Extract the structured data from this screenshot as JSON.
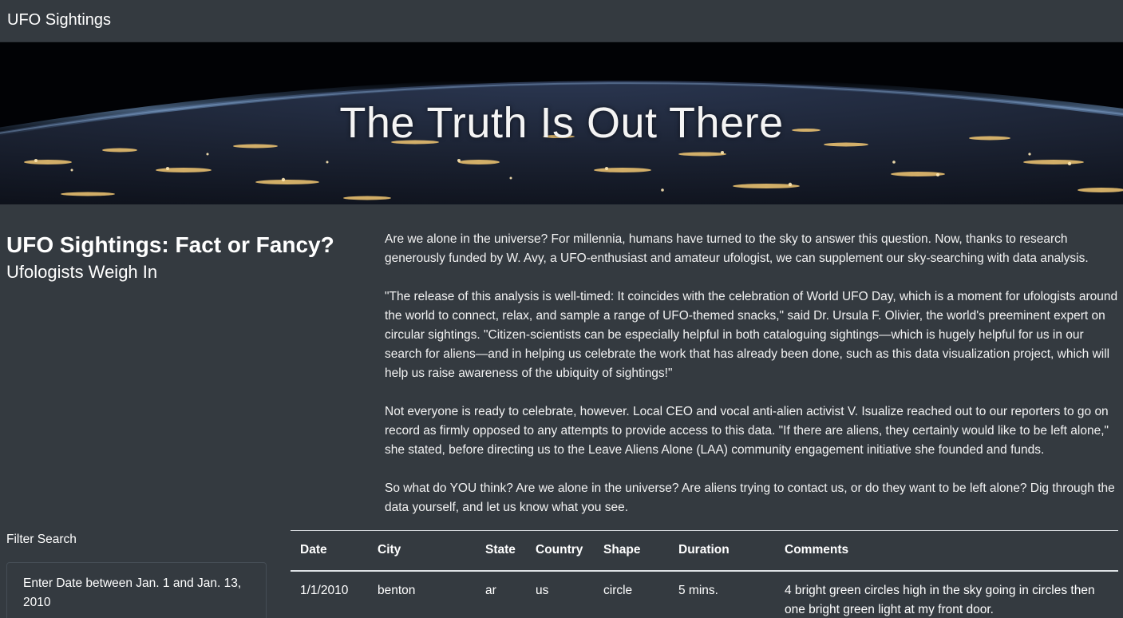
{
  "navbar": {
    "brand": "UFO Sightings"
  },
  "hero": {
    "title": "The Truth Is Out There"
  },
  "intro": {
    "title": "UFO Sightings: Fact or Fancy?",
    "subtitle": "Ufologists Weigh In"
  },
  "article": {
    "paragraphs": [
      "Are we alone in the universe? For millennia, humans have turned to the sky to answer this question. Now, thanks to research generously funded by W. Avy, a UFO-enthusiast and amateur ufologist, we can supplement our sky-searching with data analysis.",
      "\"The release of this analysis is well-timed: It coincides with the celebration of World UFO Day, which is a moment for ufologists around the world to connect, relax, and sample a range of UFO-themed snacks,\" said Dr. Ursula F. Olivier, the world's preeminent expert on circular sightings. \"Citizen-scientists can be especially helpful in both cataloguing sightings—which is hugely helpful for us in our search for aliens—and in helping us celebrate the work that has already been done, such as this data visualization project, which will help us raise awareness of the ubiquity of sightings!\"",
      "Not everyone is ready to celebrate, however. Local CEO and vocal anti-alien activist V. Isualize reached out to our reporters to go on record as firmly opposed to any attempts to provide access to this data. \"If there are aliens, they certainly would like to be left alone,\" she stated, before directing us to the Leave Aliens Alone (LAA) community engagement initiative she founded and funds.",
      "So what do YOU think? Are we alone in the universe? Are aliens trying to contact us, or do they want to be left alone? Dig through the data yourself, and let us know what you see."
    ]
  },
  "filter": {
    "heading": "Filter Search",
    "date_label": "Enter Date between Jan. 1 and Jan. 13, 2010",
    "date_value": ""
  },
  "table": {
    "headers": {
      "date": "Date",
      "city": "City",
      "state": "State",
      "country": "Country",
      "shape": "Shape",
      "duration": "Duration",
      "comments": "Comments"
    },
    "rows": [
      {
        "date": "1/1/2010",
        "city": "benton",
        "state": "ar",
        "country": "us",
        "shape": "circle",
        "duration": "5 mins.",
        "comments": "4 bright green circles high in the sky going in circles then one bright green light at my front door."
      }
    ]
  }
}
